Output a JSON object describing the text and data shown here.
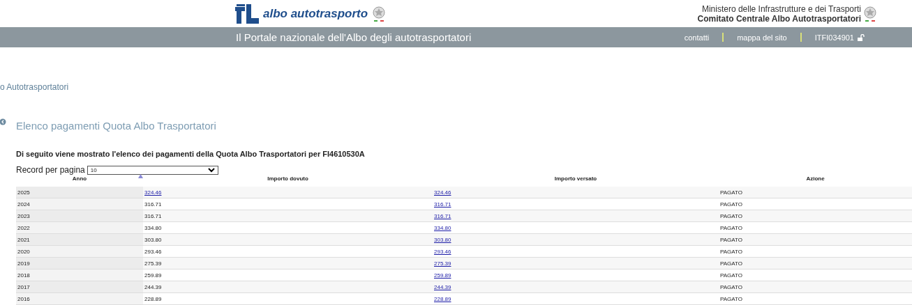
{
  "header": {
    "logo_text": "albo autotrasporto",
    "ministry": "Ministero delle Infrastrutture e dei Trasporti",
    "committee": "Comitato Centrale Albo Autotrasportatori"
  },
  "nav_bar": {
    "title": "Il Portale nazionale dell'Albo degli autotrasportatori",
    "links": [
      "contatti",
      "mappa del sito"
    ],
    "user": "ITFI034901"
  },
  "breadcrumb": "o Autotrasportatori",
  "page_title": "Elenco pagamenti Quota Albo Trasportatori",
  "description": "Di seguito viene mostrato l'elenco dei pagamenti della Quota Albo Trasportatori per FI4610530A",
  "page_size": {
    "label": "Record per pagina",
    "value": "10"
  },
  "table": {
    "columns": [
      {
        "label": "Anno",
        "sorted": true
      },
      {
        "label": "Importo dovuto",
        "sorted": false
      },
      {
        "label": "Importo versato",
        "sorted": false
      },
      {
        "label": "Azione",
        "sorted": false
      }
    ],
    "rows": [
      {
        "year": "2025",
        "due": "324.46",
        "due_link": true,
        "paid": "324.46",
        "action": "PAGATO"
      },
      {
        "year": "2024",
        "due": "316.71",
        "due_link": false,
        "paid": "316.71",
        "action": "PAGATO"
      },
      {
        "year": "2023",
        "due": "316.71",
        "due_link": false,
        "paid": "316.71",
        "action": "PAGATO"
      },
      {
        "year": "2022",
        "due": "334.80",
        "due_link": false,
        "paid": "334.80",
        "action": "PAGATO"
      },
      {
        "year": "2021",
        "due": "303.80",
        "due_link": false,
        "paid": "303.80",
        "action": "PAGATO"
      },
      {
        "year": "2020",
        "due": "293.46",
        "due_link": false,
        "paid": "293.46",
        "action": "PAGATO"
      },
      {
        "year": "2019",
        "due": "275.39",
        "due_link": false,
        "paid": "275.39",
        "action": "PAGATO"
      },
      {
        "year": "2018",
        "due": "259.89",
        "due_link": false,
        "paid": "259.89",
        "action": "PAGATO"
      },
      {
        "year": "2017",
        "due": "244.39",
        "due_link": false,
        "paid": "244.39",
        "action": "PAGATO"
      },
      {
        "year": "2016",
        "due": "228.89",
        "due_link": false,
        "paid": "228.89",
        "action": "PAGATO"
      }
    ]
  }
}
